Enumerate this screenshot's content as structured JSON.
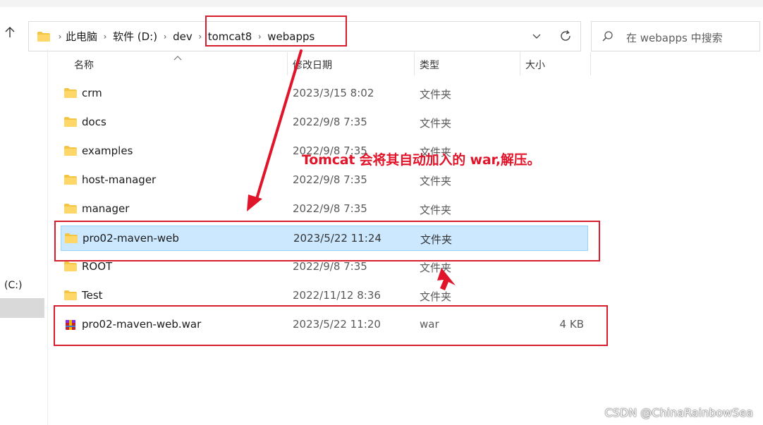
{
  "address_bar": {
    "breadcrumbs": [
      "此电脑",
      "软件 (D:)",
      "dev",
      "tomcat8",
      "webapps"
    ]
  },
  "search": {
    "placeholder": "在 webapps 中搜索"
  },
  "nav_pane": {
    "items": [
      "(C:)"
    ]
  },
  "columns": {
    "name": "名称",
    "date": "修改日期",
    "type": "类型",
    "size": "大小"
  },
  "files": [
    {
      "name": "crm",
      "date": "2023/3/15 8:02",
      "type": "文件夹",
      "size": "",
      "icon": "folder-icon"
    },
    {
      "name": "docs",
      "date": "2022/9/8 7:35",
      "type": "文件夹",
      "size": "",
      "icon": "folder-icon"
    },
    {
      "name": "examples",
      "date": "2022/9/8 7:35",
      "type": "文件夹",
      "size": "",
      "icon": "folder-icon"
    },
    {
      "name": "host-manager",
      "date": "2022/9/8 7:35",
      "type": "文件夹",
      "size": "",
      "icon": "folder-icon"
    },
    {
      "name": "manager",
      "date": "2022/9/8 7:35",
      "type": "文件夹",
      "size": "",
      "icon": "folder-icon"
    },
    {
      "name": "pro02-maven-web",
      "date": "2023/5/22 11:24",
      "type": "文件夹",
      "size": "",
      "icon": "folder-icon",
      "selected": true
    },
    {
      "name": "ROOT",
      "date": "2022/9/8 7:35",
      "type": "文件夹",
      "size": "",
      "icon": "folder-icon"
    },
    {
      "name": "Test",
      "date": "2022/11/12 8:36",
      "type": "文件夹",
      "size": "",
      "icon": "folder-icon"
    },
    {
      "name": "pro02-maven-web.war",
      "date": "2023/5/22 11:20",
      "type": "war",
      "size": "4 KB",
      "icon": "war-archive-icon"
    }
  ],
  "annotation": {
    "text": "Tomcat 会将其自动加入的 war,解压。",
    "color": "#e0152a"
  },
  "watermark": "CSDN @ChinaRainbowSea",
  "colors": {
    "selection": "#cce8ff",
    "selection_border": "#99d1ff",
    "annotation_box": "#d81e2c",
    "folder": "#f4c542"
  }
}
